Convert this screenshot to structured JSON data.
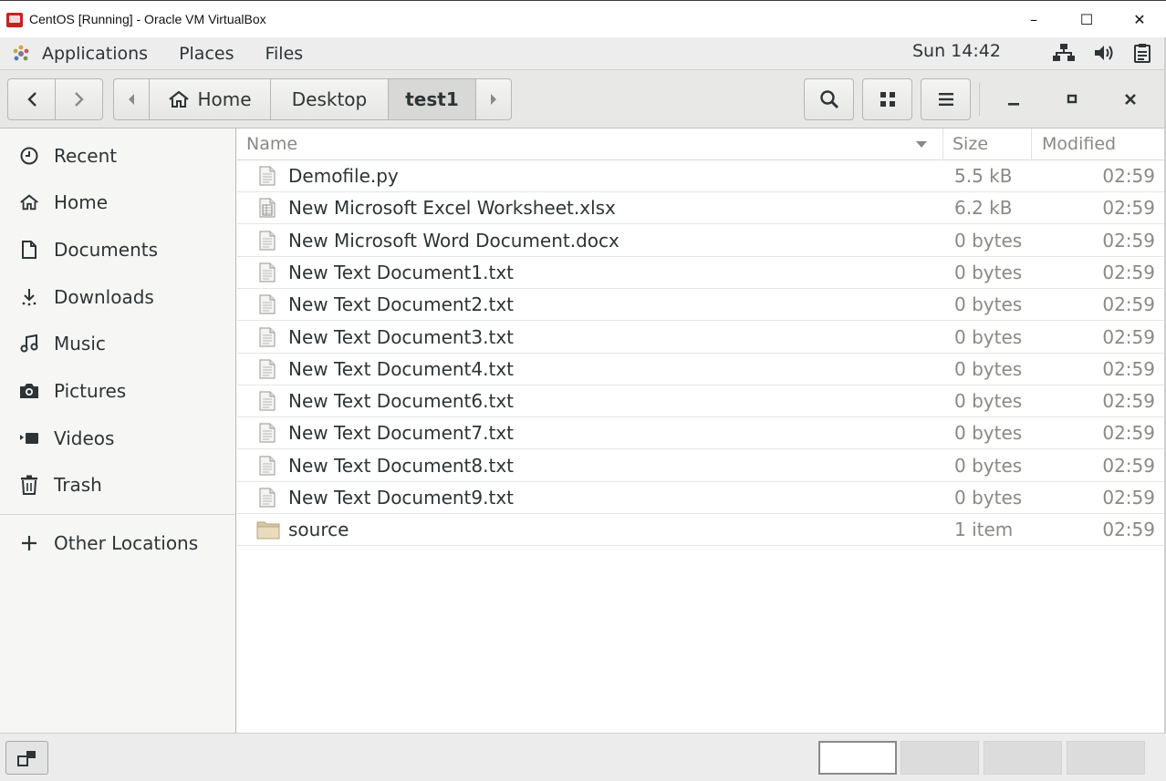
{
  "window": {
    "title": "CentOS [Running] - Oracle VM VirtualBox",
    "minimize_glyph": "–",
    "maximize_glyph": "☐",
    "close_glyph": "✕"
  },
  "gnome_bar": {
    "applications": "Applications",
    "places": "Places",
    "files": "Files",
    "clock": "Sun 14:42",
    "tray_icons": [
      "network-icon",
      "volume-icon",
      "clipboard-icon"
    ]
  },
  "headerbar": {
    "path": [
      {
        "label": "Home",
        "icon": "home-icon"
      },
      {
        "label": "Desktop"
      },
      {
        "label": "test1",
        "current": true
      }
    ]
  },
  "sidebar": {
    "items": [
      {
        "label": "Recent",
        "icon": "clock-icon"
      },
      {
        "label": "Home",
        "icon": "home-icon"
      },
      {
        "label": "Documents",
        "icon": "document-icon"
      },
      {
        "label": "Downloads",
        "icon": "download-icon"
      },
      {
        "label": "Music",
        "icon": "music-icon"
      },
      {
        "label": "Pictures",
        "icon": "camera-icon"
      },
      {
        "label": "Videos",
        "icon": "video-icon"
      },
      {
        "label": "Trash",
        "icon": "trash-icon"
      }
    ],
    "other_locations": "Other Locations"
  },
  "filelist": {
    "columns": {
      "name": "Name",
      "size": "Size",
      "modified": "Modified"
    },
    "rows": [
      {
        "name": "Demofile.py",
        "size": "5.5 kB",
        "modified": "02:59",
        "icon": "text-file-icon"
      },
      {
        "name": "New Microsoft Excel Worksheet.xlsx",
        "size": "6.2 kB",
        "modified": "02:59",
        "icon": "spreadsheet-file-icon"
      },
      {
        "name": "New Microsoft Word Document.docx",
        "size": "0 bytes",
        "modified": "02:59",
        "icon": "text-file-icon"
      },
      {
        "name": "New Text Document1.txt",
        "size": "0 bytes",
        "modified": "02:59",
        "icon": "text-file-icon"
      },
      {
        "name": "New Text Document2.txt",
        "size": "0 bytes",
        "modified": "02:59",
        "icon": "text-file-icon"
      },
      {
        "name": "New Text Document3.txt",
        "size": "0 bytes",
        "modified": "02:59",
        "icon": "text-file-icon"
      },
      {
        "name": "New Text Document4.txt",
        "size": "0 bytes",
        "modified": "02:59",
        "icon": "text-file-icon"
      },
      {
        "name": "New Text Document6.txt",
        "size": "0 bytes",
        "modified": "02:59",
        "icon": "text-file-icon"
      },
      {
        "name": "New Text Document7.txt",
        "size": "0 bytes",
        "modified": "02:59",
        "icon": "text-file-icon"
      },
      {
        "name": "New Text Document8.txt",
        "size": "0 bytes",
        "modified": "02:59",
        "icon": "text-file-icon"
      },
      {
        "name": "New Text Document9.txt",
        "size": "0 bytes",
        "modified": "02:59",
        "icon": "text-file-icon"
      },
      {
        "name": "source",
        "size": "1 item",
        "modified": "02:59",
        "icon": "folder-icon"
      }
    ]
  },
  "colors": {
    "accent_red": "#c62222",
    "sidebar_bg": "#f6f6f5",
    "header_bg": "#e8e8e7",
    "muted_text": "#888a85",
    "text": "#2e3436"
  }
}
